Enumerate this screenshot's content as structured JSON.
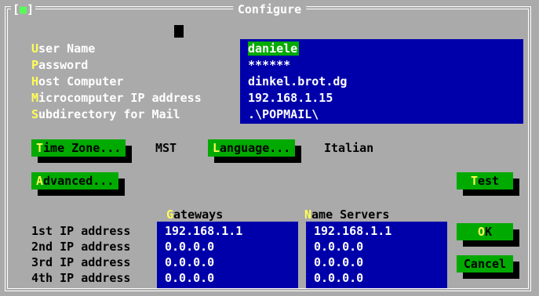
{
  "window": {
    "title": "Configure",
    "close_glyph": "■"
  },
  "form": {
    "fields": [
      {
        "hotkey": "U",
        "rest": "ser Name",
        "value": "daniele"
      },
      {
        "hotkey": "P",
        "rest": "assword",
        "value": "******"
      },
      {
        "hotkey": "H",
        "rest": "ost Computer",
        "value": "dinkel.brot.dg"
      },
      {
        "hotkey": "M",
        "rest": "icrocomputer IP address",
        "value": "192.168.1.15"
      },
      {
        "hotkey": "S",
        "rest": "ubdirectory for Mail",
        "value": ".\\POPMAIL\\"
      }
    ]
  },
  "timezone": {
    "hotkey": "T",
    "rest": "ime Zone...",
    "value": "MST"
  },
  "language": {
    "hotkey": "L",
    "rest": "anguage...",
    "value": "Italian"
  },
  "advanced": {
    "hotkey": "A",
    "rest": "dvanced..."
  },
  "buttons": {
    "test": {
      "hotkey": "T",
      "rest": "est"
    },
    "ok": {
      "hotkey": "O",
      "rest": "K"
    },
    "cancel": {
      "label": "Cancel"
    }
  },
  "ip_table": {
    "gateways_header": {
      "hotkey": "G",
      "rest": "ateways"
    },
    "nameservers_header": {
      "hotkey": "N",
      "rest": "ame Servers"
    },
    "rows": [
      {
        "label": "1st IP address",
        "gateway": "192.168.1.1",
        "nameserver": "192.168.1.1"
      },
      {
        "label": "2nd IP address",
        "gateway": "0.0.0.0",
        "nameserver": "0.0.0.0"
      },
      {
        "label": "3rd IP address",
        "gateway": "0.0.0.0",
        "nameserver": "0.0.0.0"
      },
      {
        "label": "4th IP address",
        "gateway": "0.0.0.0",
        "nameserver": "0.0.0.0"
      }
    ]
  },
  "colors": {
    "dialog_bg": "#aaaaaa",
    "field_bg": "#0000aa",
    "button_bg": "#00aa00",
    "hotkey": "#ffff55",
    "text_light": "#ffffff",
    "text_dark": "#000000"
  }
}
